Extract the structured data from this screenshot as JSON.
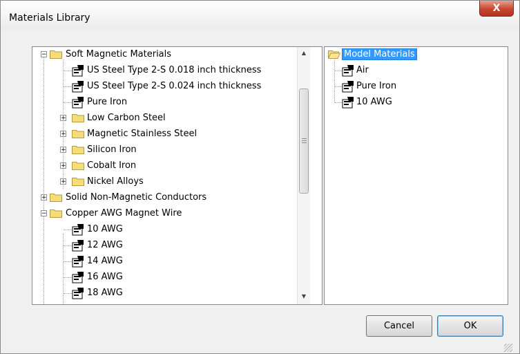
{
  "window": {
    "title": "Materials Library",
    "close_label": "X"
  },
  "library_tree": {
    "rows": [
      {
        "label": "Soft Magnetic Materials",
        "kind": "folder",
        "expander": "−"
      },
      {
        "label": "US Steel Type 2-S 0.018 inch thickness",
        "kind": "material"
      },
      {
        "label": "US Steel Type 2-S 0.024 inch thickness",
        "kind": "material"
      },
      {
        "label": "Pure Iron",
        "kind": "material"
      },
      {
        "label": "Low Carbon Steel",
        "kind": "folder",
        "expander": "+"
      },
      {
        "label": "Magnetic Stainless Steel",
        "kind": "folder",
        "expander": "+"
      },
      {
        "label": "Silicon Iron",
        "kind": "folder",
        "expander": "+"
      },
      {
        "label": "Cobalt Iron",
        "kind": "folder",
        "expander": "+"
      },
      {
        "label": "Nickel Alloys",
        "kind": "folder",
        "expander": "+"
      },
      {
        "label": "Solid Non-Magnetic Conductors",
        "kind": "folder",
        "expander": "+"
      },
      {
        "label": "Copper AWG Magnet Wire",
        "kind": "folder",
        "expander": "−"
      },
      {
        "label": "10 AWG",
        "kind": "material"
      },
      {
        "label": "12 AWG",
        "kind": "material"
      },
      {
        "label": "14 AWG",
        "kind": "material"
      },
      {
        "label": "16 AWG",
        "kind": "material"
      },
      {
        "label": "18 AWG",
        "kind": "material"
      }
    ]
  },
  "model_tree": {
    "root_label": "Model Materials",
    "items": [
      {
        "label": "Air"
      },
      {
        "label": "Pure Iron"
      },
      {
        "label": "10 AWG"
      }
    ]
  },
  "buttons": {
    "cancel": "Cancel",
    "ok": "OK"
  },
  "icons": {
    "folder": "folder-icon",
    "material": "material-icon",
    "close": "close-icon"
  },
  "colors": {
    "selection": "#3399ff",
    "folder": "#f5dd7a",
    "close_button": "#c7462f"
  }
}
